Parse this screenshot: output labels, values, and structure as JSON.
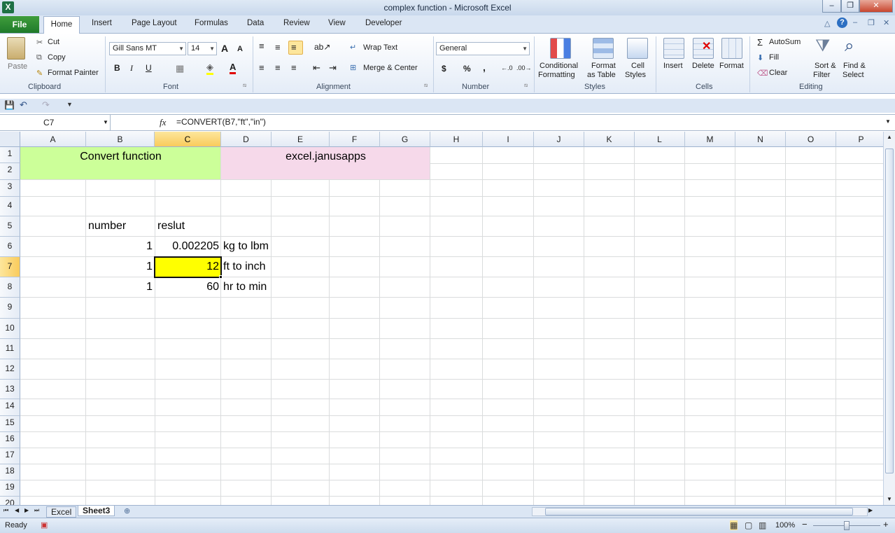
{
  "window": {
    "title": "complex function  -  Microsoft Excel",
    "min_label": "–",
    "max_label": "❐",
    "close_label": "✕"
  },
  "tabs": {
    "file": "File",
    "home": "Home",
    "insert": "Insert",
    "page_layout": "Page Layout",
    "formulas": "Formulas",
    "data": "Data",
    "review": "Review",
    "view": "View",
    "developer": "Developer"
  },
  "clipboard": {
    "paste": "Paste",
    "cut": "Cut",
    "copy": "Copy",
    "format_painter": "Format Painter",
    "label": "Clipboard"
  },
  "font": {
    "name": "Gill Sans MT",
    "size": "14",
    "grow": "A",
    "shrink": "A",
    "bold": "B",
    "italic": "I",
    "underline": "U",
    "color_glyph": "A",
    "label": "Font"
  },
  "alignment": {
    "wrap_text": "Wrap Text",
    "merge_center": "Merge & Center",
    "label": "Alignment"
  },
  "number": {
    "format": "General",
    "currency": "$",
    "percent": "%",
    "comma": ",",
    "label": "Number"
  },
  "styles": {
    "conditional": "Conditional",
    "conditional2": "Formatting",
    "format_as": "Format",
    "format_as2": "as Table",
    "cell": "Cell",
    "cell2": "Styles",
    "label": "Styles"
  },
  "cells": {
    "insert": "Insert",
    "delete": "Delete",
    "format": "Format",
    "label": "Cells"
  },
  "editing": {
    "autosum": "AutoSum",
    "fill": "Fill",
    "clear": "Clear",
    "sort": "Sort &",
    "sort2": "Filter",
    "find": "Find &",
    "find2": "Select",
    "label": "Editing"
  },
  "formula_bar": {
    "name_box": "C7",
    "fx": "fx",
    "formula": "=CONVERT(B7,\"ft\",\"in\")"
  },
  "columns": [
    "A",
    "B",
    "C",
    "D",
    "E",
    "F",
    "G",
    "H",
    "I",
    "J",
    "K",
    "L",
    "M",
    "N",
    "O",
    "P"
  ],
  "rows": [
    "1",
    "2",
    "3",
    "4",
    "5",
    "6",
    "7",
    "8",
    "9",
    "10",
    "11",
    "12",
    "13",
    "14",
    "15",
    "16",
    "17",
    "18",
    "19",
    "20"
  ],
  "cells_data": {
    "b1": "Convert function",
    "d1": "excel.janusapps",
    "b5": "number",
    "c5": "reslut",
    "b6": "1",
    "c6": "0.002205",
    "d6": "kg to lbm",
    "b7": "1",
    "c7": "12",
    "d7": "ft to inch",
    "b8": "1",
    "c8": "60",
    "d8": "hr to min"
  },
  "colors": {
    "green_fill": "#ccff99",
    "pink_fill": "#f6d9ea",
    "selected_fill": "#ffff00"
  },
  "sheets": {
    "sheet1": "Excel",
    "sheet2": "Sheet3"
  },
  "status": {
    "ready": "Ready",
    "zoom": "100%",
    "minus": "−",
    "plus": "+"
  }
}
